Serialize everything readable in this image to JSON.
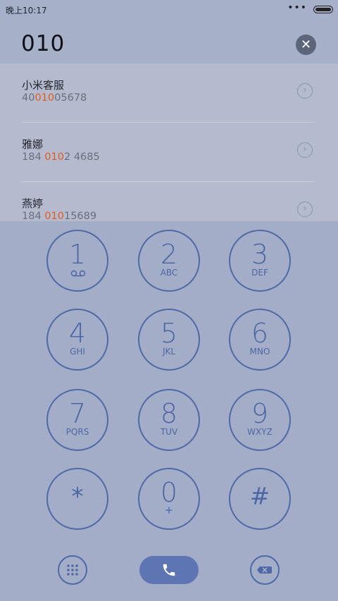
{
  "status_bar": {
    "time": "晚上10:17",
    "signal_dots": "•••"
  },
  "dial": {
    "number": "010"
  },
  "results": [
    {
      "name": "小米客服",
      "number_pre": "40",
      "number_match": "010",
      "number_post": "05678"
    },
    {
      "name": "雅娜",
      "number_pre": "184 ",
      "number_match": "010",
      "number_post": "2 4685"
    },
    {
      "name": "燕婷",
      "number_pre": "184 ",
      "number_match": "010",
      "number_post": "15689"
    }
  ],
  "keypad": {
    "k1": {
      "digit": "1"
    },
    "k2": {
      "digit": "2",
      "letters": "ABC"
    },
    "k3": {
      "digit": "3",
      "letters": "DEF"
    },
    "k4": {
      "digit": "4",
      "letters": "GHI"
    },
    "k5": {
      "digit": "5",
      "letters": "JKL"
    },
    "k6": {
      "digit": "6",
      "letters": "MNO"
    },
    "k7": {
      "digit": "7",
      "letters": "PQRS"
    },
    "k8": {
      "digit": "8",
      "letters": "TUV"
    },
    "k9": {
      "digit": "9",
      "letters": "WXYZ"
    },
    "star": {
      "symbol": "*"
    },
    "k0": {
      "digit": "0",
      "letters": "+"
    },
    "hash": {
      "symbol": "#"
    }
  },
  "colors": {
    "accent": "#4e69a6",
    "highlight": "#e6591c",
    "call_button": "#5d75b2"
  }
}
